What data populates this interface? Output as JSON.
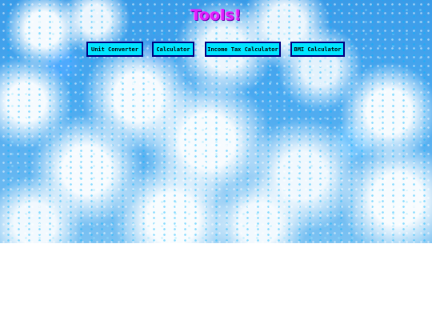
{
  "page": {
    "title": "Tools!",
    "title_color": "#e020ff"
  },
  "nav": {
    "button_color": "#00e5ff",
    "button_border_color": "#000080",
    "buttons": [
      {
        "label": "Unit Converter"
      },
      {
        "label": "Calculator"
      },
      {
        "label": "Income Tax Calculator"
      },
      {
        "label": "BMI Calculator"
      }
    ]
  }
}
